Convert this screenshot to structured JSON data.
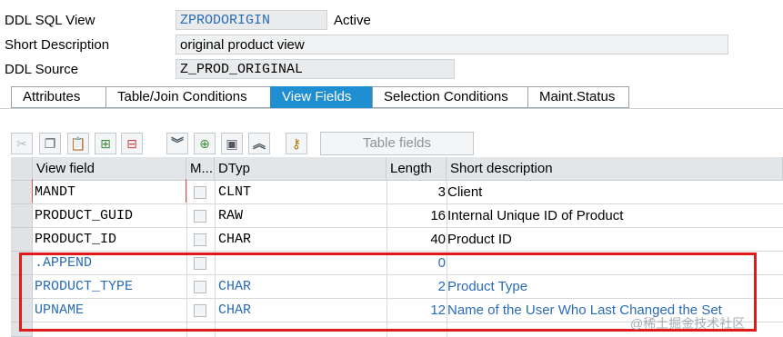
{
  "header": {
    "view_label": "DDL SQL View",
    "view_value": "ZPRODORIGIN",
    "view_status": "Active",
    "desc_label": "Short Description",
    "desc_value": "original product view",
    "source_label": "DDL Source",
    "source_value": "Z_PROD_ORIGINAL"
  },
  "tabs": [
    {
      "label": "Attributes",
      "active": false
    },
    {
      "label": "Table/Join Conditions",
      "active": false
    },
    {
      "label": "View Fields",
      "active": true
    },
    {
      "label": "Selection Conditions",
      "active": false
    },
    {
      "label": "Maint.Status",
      "active": false
    }
  ],
  "toolbar": {
    "icons": [
      "cut-icon",
      "copy-icon",
      "paste-icon",
      "insert-row-icon",
      "delete-row-icon",
      "collapse-icon",
      "insert-icon",
      "display-icon",
      "expand-icon",
      "key-icon"
    ],
    "table_fields_label": "Table fields"
  },
  "grid": {
    "columns": [
      "View field",
      "M...",
      "DTyp",
      "Length",
      "Short description"
    ],
    "rows": [
      {
        "field": "MANDT",
        "dtyp": "CLNT",
        "length": "3",
        "desc": "Client",
        "append": false
      },
      {
        "field": "PRODUCT_GUID",
        "dtyp": "RAW",
        "length": "16",
        "desc": "Internal Unique ID of Product",
        "append": false
      },
      {
        "field": "PRODUCT_ID",
        "dtyp": "CHAR",
        "length": "40",
        "desc": "Product ID",
        "append": false
      },
      {
        "field": ".APPEND",
        "dtyp": "",
        "length": "0",
        "desc": "",
        "append": true
      },
      {
        "field": "PRODUCT_TYPE",
        "dtyp": "CHAR",
        "length": "2",
        "desc": "Product Type",
        "append": true
      },
      {
        "field": "UPNAME",
        "dtyp": "CHAR",
        "length": "12",
        "desc": "Name of the User Who Last Changed the Set",
        "append": true
      }
    ]
  },
  "watermark": "@稀土掘金技术社区",
  "colors": {
    "active_tab": "#1f8fd1",
    "append_text": "#2a6cb4",
    "highlight": "#e0191b"
  }
}
